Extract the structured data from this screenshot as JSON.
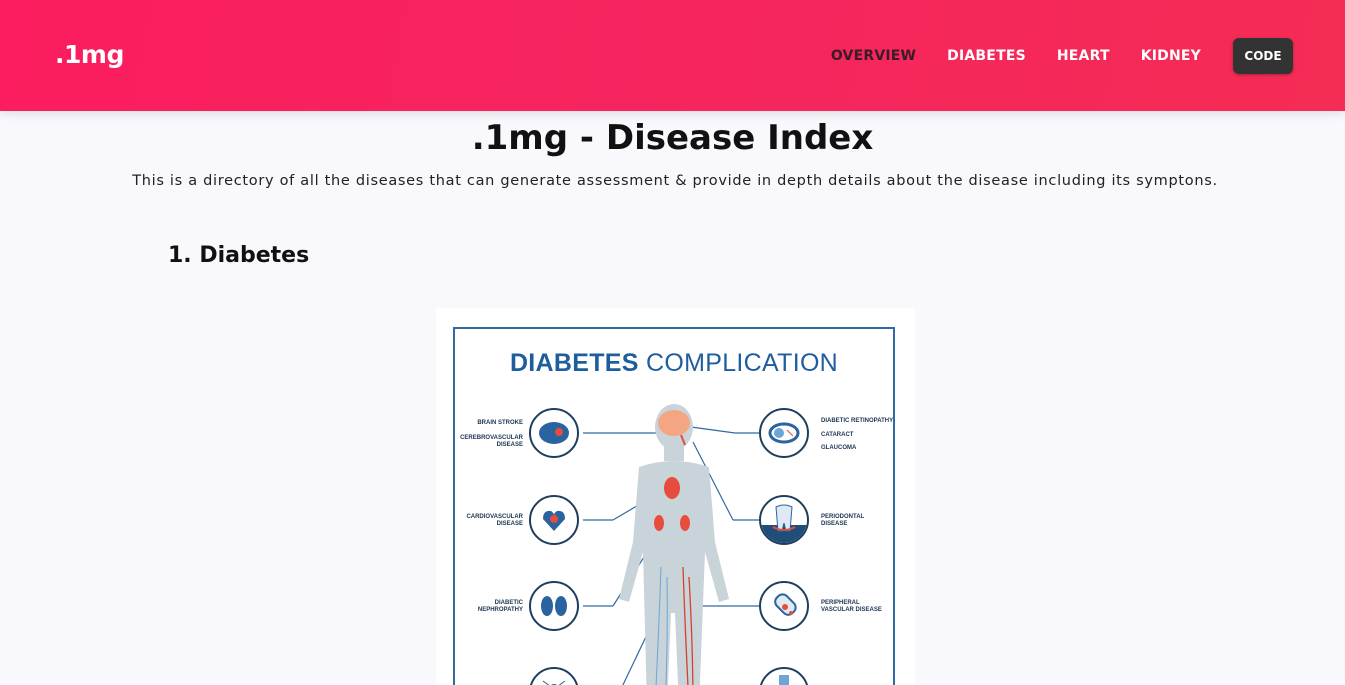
{
  "header": {
    "logo": ".1mg",
    "nav": [
      {
        "label": "OVERVIEW",
        "active": true
      },
      {
        "label": "DIABETES",
        "active": false
      },
      {
        "label": "HEART",
        "active": false
      },
      {
        "label": "KIDNEY",
        "active": false
      }
    ],
    "code_button": "CODE",
    "colors": {
      "gradient_start": "#fb1d5f",
      "gradient_end": "#f52c54",
      "active_link": "#3a1c24"
    }
  },
  "main": {
    "title": ".1mg - Disease Index",
    "description": "This is a directory of all the diseases that can generate assessment & provide in depth details about the disease including its symptons.",
    "sections": [
      {
        "heading": "1. Diabetes"
      }
    ]
  },
  "poster": {
    "title_bold": "DIABETES",
    "title_rest": "COMPLICATION",
    "left_labels": [
      {
        "lines": [
          "BRAIN STROKE"
        ]
      },
      {
        "lines": [
          "CEREBROVASCULAR",
          "DISEASE"
        ]
      },
      {
        "lines": [
          "CARDIOVASCULAR",
          "DISEASE"
        ]
      },
      {
        "lines": [
          "DIABETIC",
          "NEPHROPATHY"
        ]
      }
    ],
    "right_labels": [
      {
        "lines": [
          "DIABETIC RETINOPATHY"
        ]
      },
      {
        "lines": [
          "CATARACT"
        ]
      },
      {
        "lines": [
          "GLAUCOMA"
        ]
      },
      {
        "lines": [
          "PERIODONTAL",
          "DISEASE"
        ]
      },
      {
        "lines": [
          "PERIPHERAL",
          "VASCULAR DISEASE"
        ]
      }
    ],
    "icons": [
      "brain-icon",
      "heart-icon",
      "kidney-icon",
      "nerve-icon",
      "eye-icon",
      "tooth-icon",
      "blood-vessel-icon",
      "foot-icon"
    ],
    "colors": {
      "title": "#1f5e9c",
      "border": "#2f6aa3",
      "organ": "#e74c3c",
      "body": "#c9d3da"
    }
  }
}
